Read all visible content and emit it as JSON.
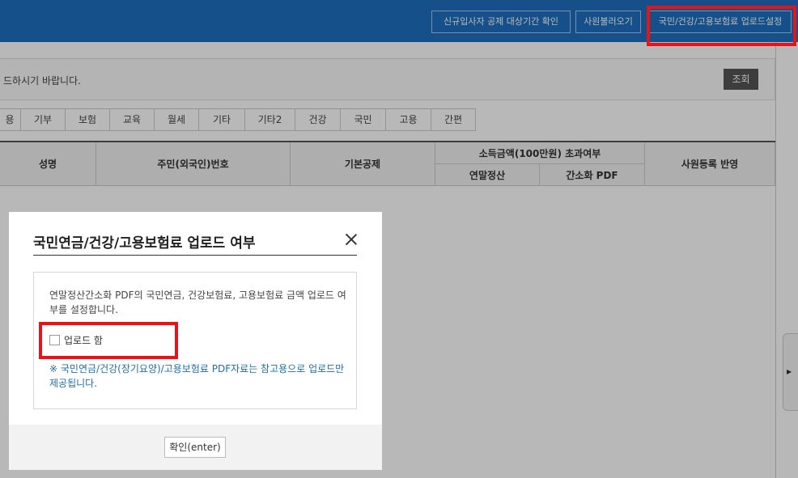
{
  "topbar": {
    "buttons": [
      "신규입사자 공제 대상기간 확인",
      "사원불러오기",
      "국민/건강/고용보험료 업로드설정"
    ]
  },
  "notice": {
    "text": "드하시기 바랍니다.",
    "query_button": "조회"
  },
  "tabs": [
    "용",
    "기부",
    "보험",
    "교육",
    "월세",
    "기타",
    "기타2",
    "건강",
    "국민",
    "고용",
    "간편"
  ],
  "grid": {
    "headers": {
      "name": "성명",
      "resident_no": "주민(외국인)번호",
      "basic_deduction": "기본공제",
      "income_excess": "소득금액(100만원) 초과여부",
      "year_end": "연말정산",
      "simplified_pdf": "간소화 PDF",
      "employee_reflect": "사원등록 반영"
    }
  },
  "modal": {
    "title": "국민연금/건강/고용보험료 업로드 여부",
    "description": "연말정산간소화 PDF의 국민연금, 건강보험료, 고용보험료 금액 업로드 여부를 설정합니다.",
    "checkbox_label": "업로드 함",
    "checkbox_checked": false,
    "note": "※ 국민연금/건강(장기요양)/고용보험료 PDF자료는 참고용으로 업로드만 제공됩니다.",
    "ok_button": "확인(enter)"
  },
  "colors": {
    "topbar": "#1f6fbf",
    "highlight": "#e4141b",
    "note_text": "#1e6fa8"
  }
}
